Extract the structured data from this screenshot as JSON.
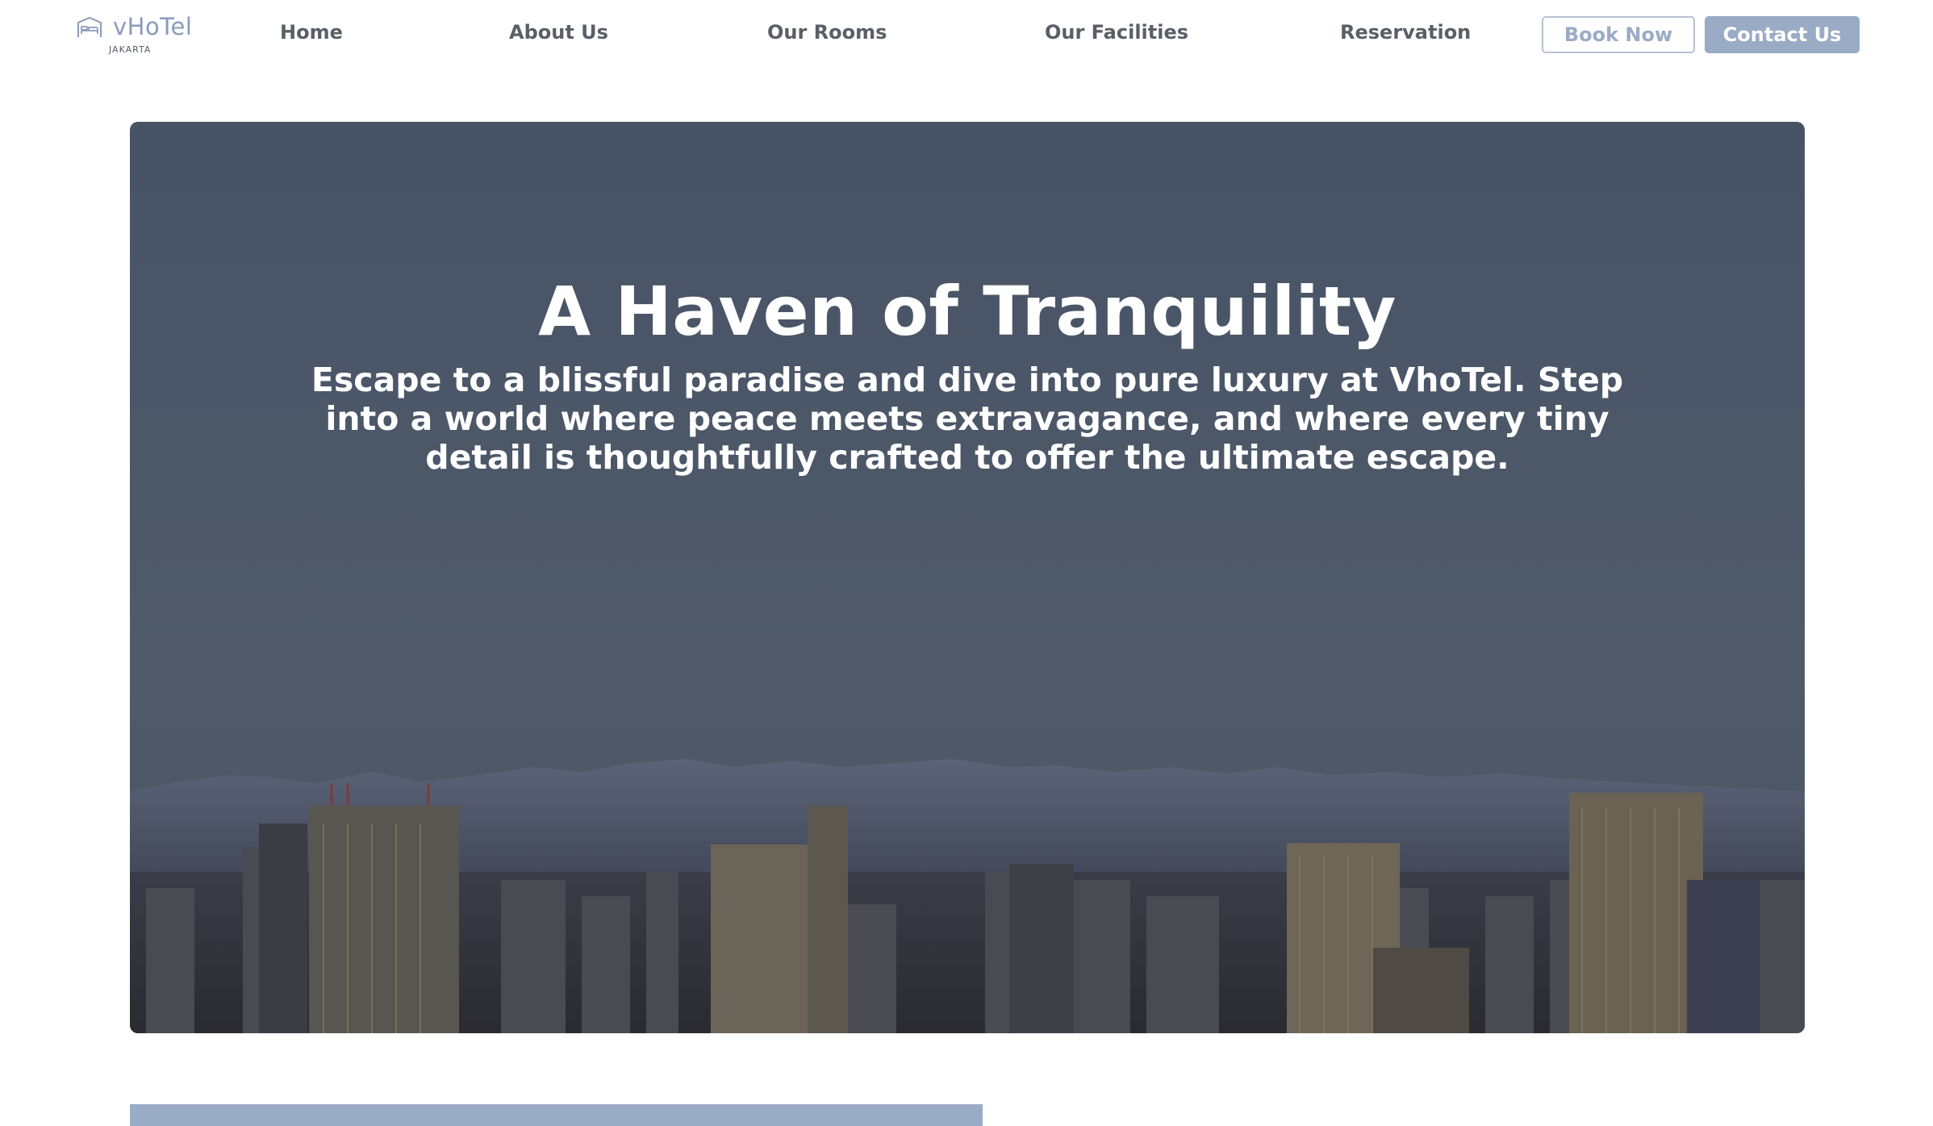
{
  "brand": {
    "name": "vHoTel",
    "location": "JAKARTA",
    "icon": "bed-icon",
    "accent_color": "#9aabc6"
  },
  "nav": {
    "items": [
      {
        "label": "Home"
      },
      {
        "label": "About Us"
      },
      {
        "label": "Our Rooms"
      },
      {
        "label": "Our Facilities"
      },
      {
        "label": "Reservation"
      }
    ],
    "book_label": "Book Now",
    "contact_label": "Contact Us"
  },
  "hero": {
    "title": "A Haven of Tranquility",
    "subtitle": "Escape to a blissful paradise and dive into pure luxury at VhoTel. Step into a world where peace meets extravagance, and where every tiny detail is thoughtfully crafted to offer the ultimate escape."
  }
}
